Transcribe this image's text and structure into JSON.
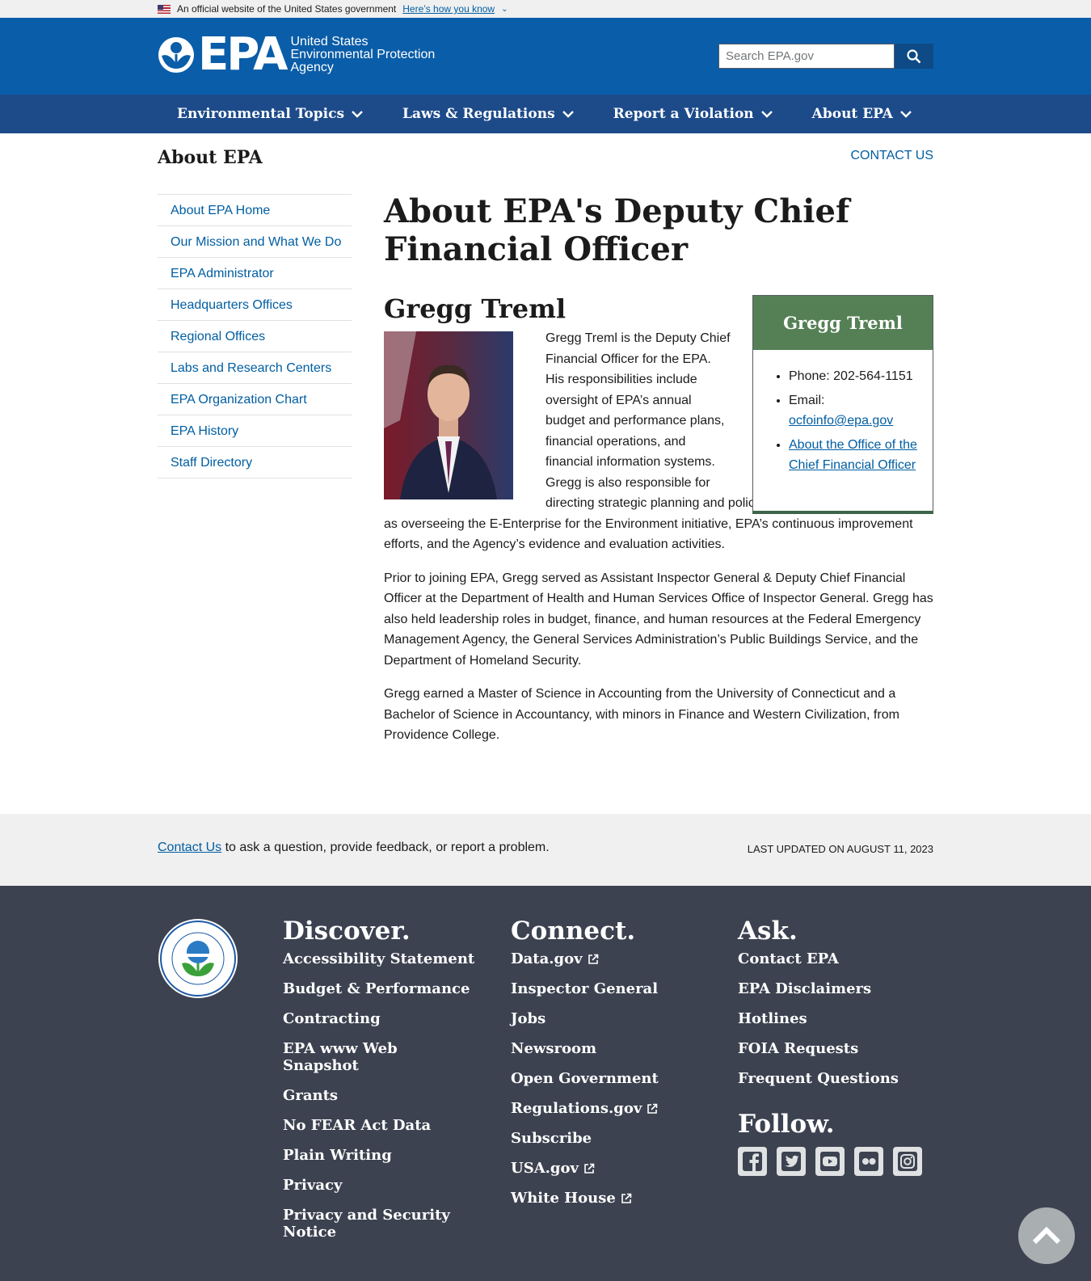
{
  "gov_banner": {
    "text": "An official website of the United States government",
    "link": "Here’s how you know"
  },
  "header": {
    "logo_acronym": "EPA",
    "logo_line1": "United States",
    "logo_line2": "Environmental Protection",
    "logo_line3": "Agency",
    "search_placeholder": "Search EPA.gov"
  },
  "nav": {
    "items": [
      {
        "label": "Environmental Topics"
      },
      {
        "label": "Laws & Regulations"
      },
      {
        "label": "Report a Violation"
      },
      {
        "label": "About EPA"
      }
    ]
  },
  "section": {
    "title": "About EPA",
    "contact_link": "CONTACT US"
  },
  "sidenav": {
    "items": [
      {
        "label": "About EPA Home"
      },
      {
        "label": "Our Mission and What We Do"
      },
      {
        "label": "EPA Administrator"
      },
      {
        "label": "Headquarters Offices"
      },
      {
        "label": "Regional Offices"
      },
      {
        "label": "Labs and Research Centers"
      },
      {
        "label": "EPA Organization Chart"
      },
      {
        "label": "EPA History"
      },
      {
        "label": "Staff Directory"
      }
    ]
  },
  "main": {
    "title": "About EPA's Deputy Chief Financial Officer",
    "name": "Gregg Treml",
    "bio_1": "Gregg Treml is the Deputy Chief Financial Officer for the EPA. His responsibilities include oversight of EPA’s annual budget and performance plans, financial operations, and financial information systems. Gregg is also responsible for directing strategic planning and policy development efforts as well as overseeing the E-Enterprise for the Environment initiative, EPA’s continuous improvement efforts, and the Agency’s evidence and evaluation activities.",
    "bio_2": "Prior to joining EPA, Gregg served as Assistant Inspector General & Deputy Chief Financial Officer at the Department of Health and Human Services Office of Inspector General. Gregg has also held leadership roles in budget, finance, and human resources at the Federal Emergency Management Agency, the General Services Administration’s Public Buildings Service, and the Department of Homeland Security.",
    "bio_3": "Gregg earned a Master of Science in Accounting from the University of Connecticut and a Bachelor of Science in Accountancy, with minors in Finance and Western Civilization, from Providence College."
  },
  "contact_box": {
    "title": "Gregg Treml",
    "phone": "Phone: 202-564-1151",
    "email_label": "Email:",
    "email": "ocfoinfo@epa.gov",
    "office_link": "About the Office of the Chief Financial Officer"
  },
  "feedback": {
    "link": "Contact Us",
    "text": " to ask a question, provide feedback, or report a problem.",
    "last_updated": "Last updated on August 11, 2023"
  },
  "footer": {
    "discover": {
      "title": "Discover.",
      "links": [
        "Accessibility Statement",
        "Budget & Performance",
        "Contracting",
        "EPA www Web Snapshot",
        "Grants",
        "No FEAR Act Data",
        "Plain Writing",
        "Privacy",
        "Privacy and Security Notice"
      ]
    },
    "connect": {
      "title": "Connect.",
      "links": [
        "Data.gov",
        "Inspector General",
        "Jobs",
        "Newsroom",
        "Open Government",
        "Regulations.gov",
        "Subscribe",
        "USA.gov",
        "White House"
      ]
    },
    "ask": {
      "title": "Ask.",
      "links": [
        "Contact EPA",
        "EPA Disclaimers",
        "Hotlines",
        "FOIA Requests",
        "Frequent Questions"
      ]
    },
    "follow_title": "Follow.",
    "social": [
      "facebook-icon",
      "twitter-icon",
      "youtube-icon",
      "flickr-icon",
      "instagram-icon"
    ],
    "seal_text": "UNITED STATES ENVIRONMENTAL PROTECTION AGENCY"
  },
  "colors": {
    "header_blue": "#0a5da8",
    "nav_blue": "#1d4b8a",
    "link_blue": "#005ea2",
    "contact_green": "#558056",
    "footer_bg": "#3c4250"
  }
}
